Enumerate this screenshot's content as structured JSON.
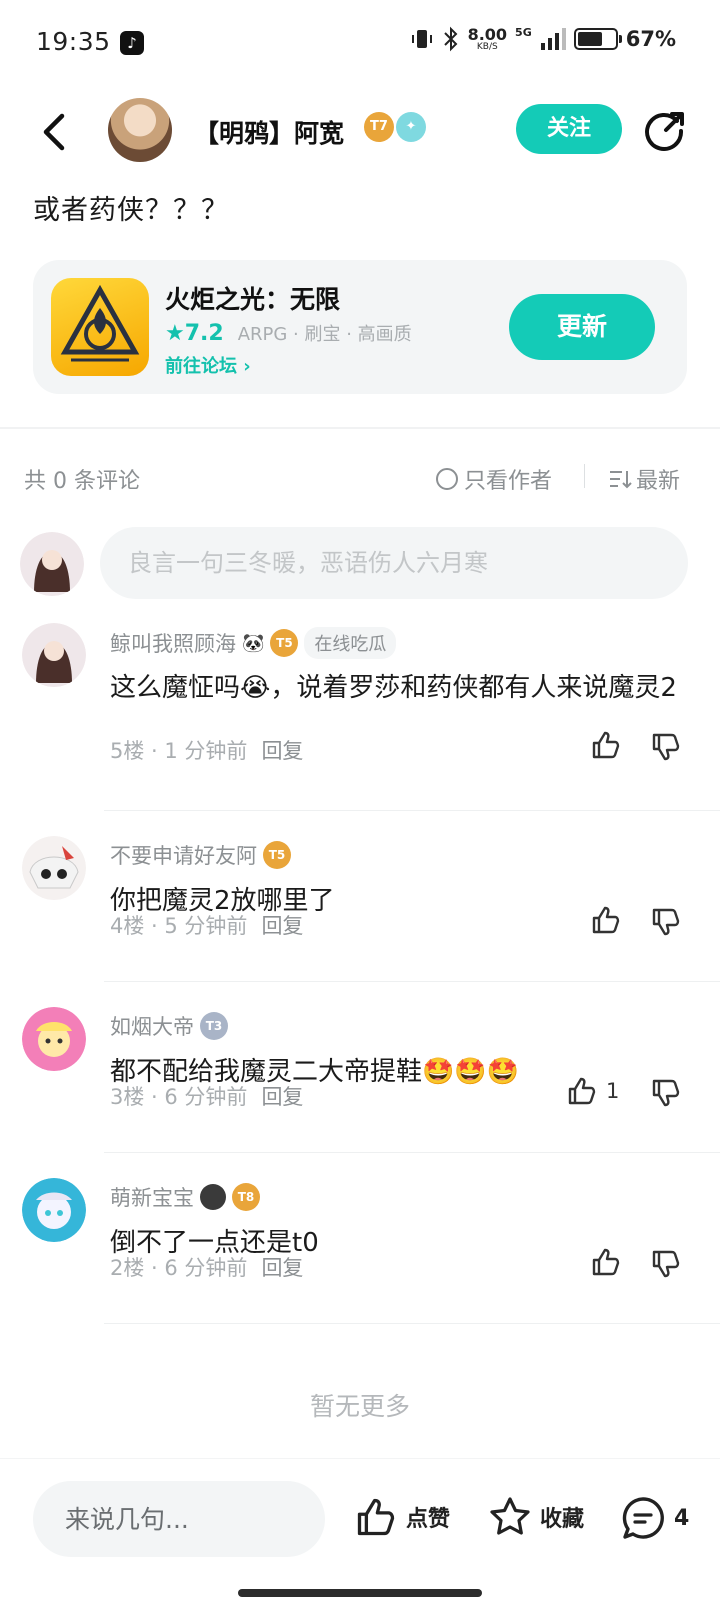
{
  "status": {
    "time": "19:35",
    "net_speed": "8.00",
    "net_unit": "KB/S",
    "signal": "5G",
    "battery_pct": "67%",
    "battery_level": 0.67
  },
  "header": {
    "author_name": "【明鸦】阿宽",
    "level_badge": "T7",
    "follow_label": "关注"
  },
  "post": {
    "text": "或者药侠？？？"
  },
  "game": {
    "title": "火炬之光：无限",
    "score": "★7.2",
    "tags": "ARPG · 刷宝 · 高画质",
    "forum_link": "前往论坛 ›",
    "update_label": "更新"
  },
  "comments_header": {
    "count": "共 0 条评论",
    "only_author": "只看作者",
    "sort": "最新"
  },
  "comment_input": {
    "placeholder": "良言一句三冬暖，恶语伤人六月寒"
  },
  "comments": [
    {
      "user": "鲸叫我照顾海",
      "badge": "T5",
      "tag": "在线吃瓜",
      "text": "这么魔怔吗😭，说着罗莎和药侠都有人来说魔灵2",
      "floor": "5楼 · 1 分钟前",
      "reply": "回复",
      "likes": ""
    },
    {
      "user": "不要申请好友阿",
      "badge": "T5",
      "tag": "",
      "text": "你把魔灵2放哪里了",
      "floor": "4楼 · 5 分钟前",
      "reply": "回复",
      "likes": ""
    },
    {
      "user": "如烟大帝",
      "badge": "T3",
      "tag": "",
      "text": "都不配给我魔灵二大帝提鞋🤩🤩🤩",
      "floor": "3楼 · 6 分钟前",
      "reply": "回复",
      "likes": "1"
    },
    {
      "user": "萌新宝宝",
      "badge": "T8",
      "tag": "",
      "text": "倒不了一点还是t0",
      "floor": "2楼 · 6 分钟前",
      "reply": "回复",
      "likes": ""
    }
  ],
  "footer": {
    "no_more": "暂无更多"
  },
  "bottom_bar": {
    "placeholder": "来说几句...",
    "like_label": "点赞",
    "fav_label": "收藏",
    "comment_count": "4"
  },
  "colors": {
    "accent": "#14cbb7",
    "muted": "#8c9093",
    "badge_gold": "#e9a53a",
    "badge_silver": "#a9b4c7"
  }
}
